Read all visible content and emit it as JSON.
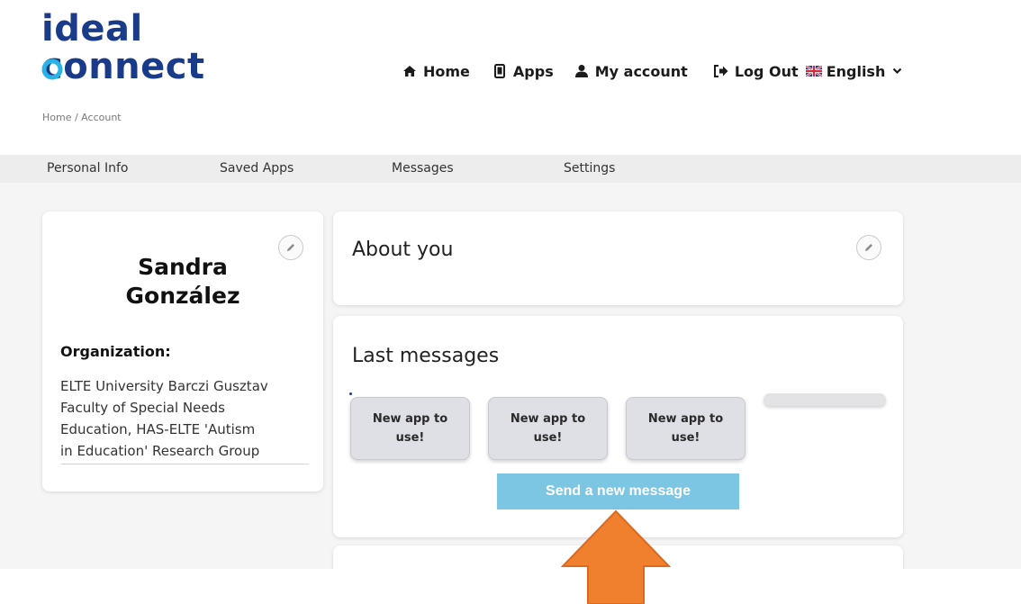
{
  "brand": {
    "logo_line1": "ideal",
    "logo_line2": "connect",
    "logo_color": "#1a3a8a",
    "logo_accent_color": "#2ab3e6"
  },
  "nav": {
    "home": {
      "label": "Home",
      "icon": "home-icon"
    },
    "apps": {
      "label": "Apps",
      "icon": "tablet-icon"
    },
    "account": {
      "label": "My account",
      "icon": "user-icon"
    },
    "logout": {
      "label": "Log Out",
      "icon": "logout-icon"
    },
    "language": {
      "label": "English",
      "icon": "uk-flag-icon"
    }
  },
  "breadcrumb": "Home / Account",
  "tabs": [
    {
      "label": "Personal Info"
    },
    {
      "label": "Saved Apps"
    },
    {
      "label": "Messages"
    },
    {
      "label": "Settings"
    }
  ],
  "profile": {
    "name_line1": "Sandra",
    "name_line2": "González",
    "organization_label": "Organization:",
    "organization_lines": [
      "ELTE University Barczi Gusztav",
      "Faculty of Special Needs",
      "Education, HAS-ELTE 'Autism",
      "in Education' Research Group"
    ]
  },
  "about": {
    "title": "About you"
  },
  "messages": {
    "title": "Last messages",
    "items": [
      {
        "line1": "New app to",
        "line2": "use!"
      },
      {
        "line1": "New app to",
        "line2": "use!"
      },
      {
        "line1": "New app to",
        "line2": "use!"
      }
    ],
    "send_label": "Send a new message"
  },
  "colors": {
    "send_button": "#7cc5e3",
    "arrow": "#f07f2e",
    "page_bg": "#f5f5f5",
    "tabbar_bg": "#ededed"
  }
}
